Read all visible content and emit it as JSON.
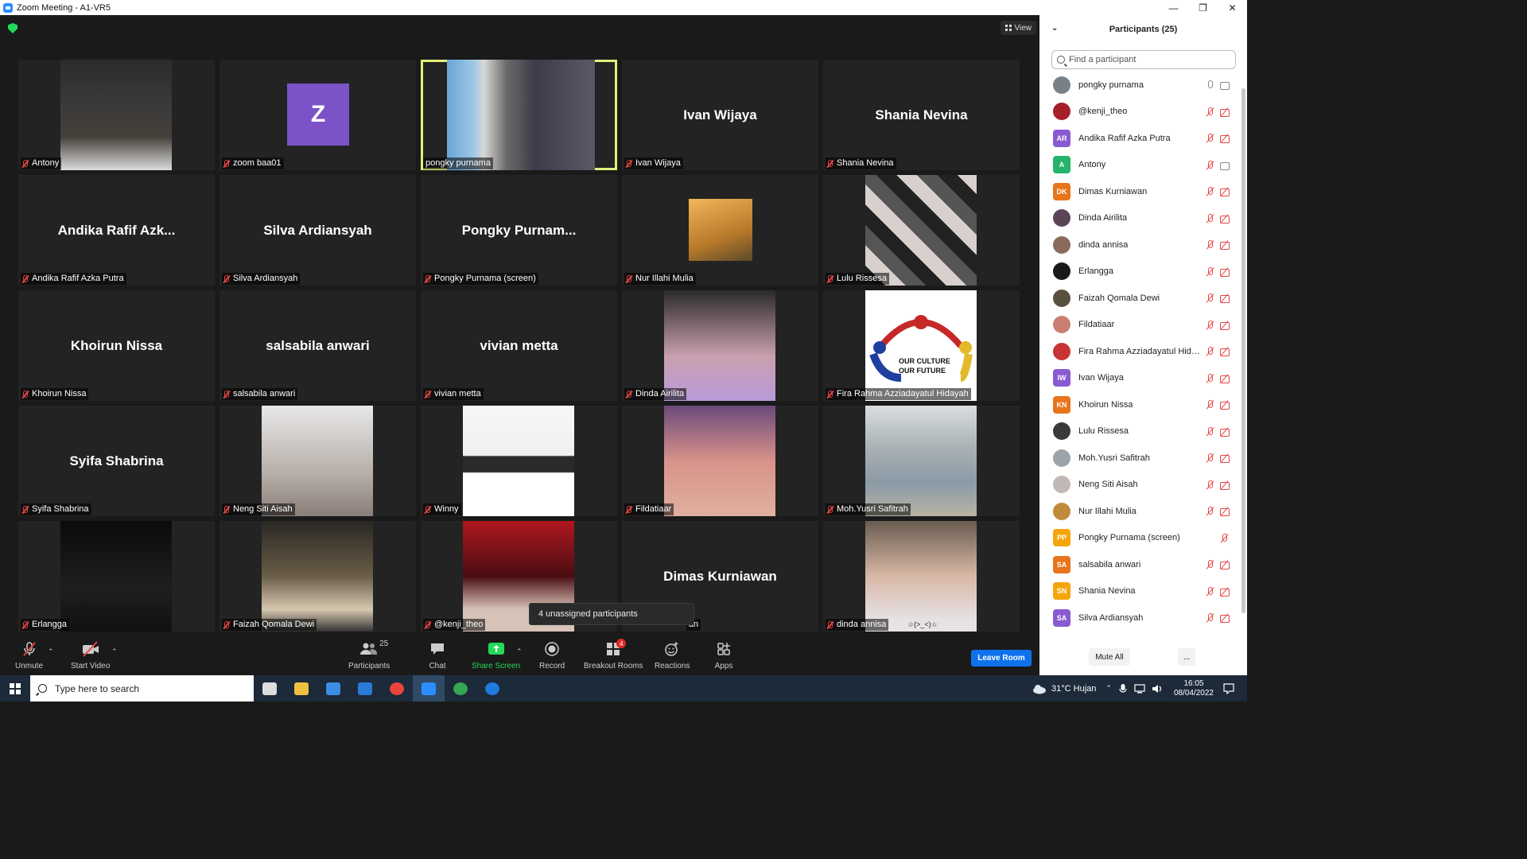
{
  "window": {
    "title": "Zoom Meeting - A1-VR5",
    "controls": [
      "—",
      "❐",
      "✕"
    ]
  },
  "meeting": {
    "view_label": "View",
    "tiles": [
      {
        "name": "Antony",
        "type": "photo",
        "photo": "ph-antony",
        "muted": true
      },
      {
        "name": "zoom baa01",
        "type": "avatar",
        "initial": "Z",
        "muted": true
      },
      {
        "name": "pongky purnama",
        "type": "photo",
        "photo": "ph-pongky",
        "muted": false,
        "active": true
      },
      {
        "name": "Ivan Wijaya",
        "type": "text",
        "display": "Ivan Wijaya",
        "muted": true
      },
      {
        "name": "Shania Nevina",
        "type": "text",
        "display": "Shania Nevina",
        "muted": true
      },
      {
        "name": "Andika Rafif Azka Putra",
        "type": "text",
        "display": "Andika  Rafif  Azk...",
        "muted": true
      },
      {
        "name": "Silva Ardiansyah",
        "type": "text",
        "display": "Silva Ardiansyah",
        "muted": true
      },
      {
        "name": "Pongky Purnama (screen)",
        "type": "text",
        "display": "Pongky  Purnam...",
        "muted": true
      },
      {
        "name": "Nur Illahi Mulia",
        "type": "photo-small",
        "photo": "ph-nur",
        "muted": true
      },
      {
        "name": "Lulu Rissesa",
        "type": "photo",
        "photo": "ph-lulu",
        "muted": true
      },
      {
        "name": "Khoirun Nissa",
        "type": "text",
        "display": "Khoirun Nissa",
        "muted": true
      },
      {
        "name": "salsabila anwari",
        "type": "text",
        "display": "salsabila anwari",
        "muted": true
      },
      {
        "name": "vivian metta",
        "type": "text",
        "display": "vivian metta",
        "muted": true
      },
      {
        "name": "Dinda Airilita",
        "type": "photo",
        "photo": "ph-dinda",
        "muted": true
      },
      {
        "name": "Fira Rahma Azziadayatul Hidayah",
        "type": "logo",
        "photo": "ph-fira",
        "logo_text": [
          "OUR CULTURE",
          "OUR FUTURE"
        ],
        "muted": true
      },
      {
        "name": "Syifa Shabrina",
        "type": "text",
        "display": "Syifa Shabrina",
        "muted": true
      },
      {
        "name": "Neng Siti Aisah",
        "type": "photo",
        "photo": "ph-neng",
        "muted": true
      },
      {
        "name": "Winny",
        "type": "photo",
        "photo": "ph-winny",
        "muted": true
      },
      {
        "name": "Fildatiaar",
        "type": "photo",
        "photo": "ph-fild",
        "muted": true
      },
      {
        "name": "Moh.Yusri Safitrah",
        "type": "photo",
        "photo": "ph-moh",
        "muted": true
      },
      {
        "name": "Erlangga",
        "type": "photo",
        "photo": "ph-erl",
        "muted": true
      },
      {
        "name": "Faizah Qomala Dewi",
        "type": "photo",
        "photo": "ph-faizah",
        "muted": true
      },
      {
        "name": "@kenji_theo",
        "type": "photo",
        "photo": "ph-kenji",
        "muted": true
      },
      {
        "name": "Dimas Kurniawan",
        "type": "text",
        "display": "Dimas Kurniawan",
        "muted": false,
        "tag_hidden": true,
        "tag_tail": "an"
      },
      {
        "name": "dinda annisa",
        "type": "photo",
        "photo": "ph-dindaa",
        "muted": true,
        "extra": "☆(>_<)☆"
      }
    ],
    "tooltip": "4 unassigned participants",
    "colors": {
      "active_border": "#e1f07a",
      "muted_red": "#e54545",
      "security_green": "#23d959"
    }
  },
  "toolbar": {
    "unmute": "Unmute",
    "start_video": "Start Video",
    "participants": "Participants",
    "participants_count": "25",
    "chat": "Chat",
    "share_screen": "Share Screen",
    "record": "Record",
    "breakout_rooms": "Breakout Rooms",
    "breakout_badge": "4",
    "reactions": "Reactions",
    "apps": "Apps",
    "leave_room": "Leave Room",
    "caret": "⌃"
  },
  "panel": {
    "title": "Participants (25)",
    "search_placeholder": "Find a participant",
    "mute_all": "Mute All",
    "more": "...",
    "participants": [
      {
        "name": "pongky purnama",
        "avatar": "photo",
        "color": "#7a8088",
        "mic": "on",
        "video": "on"
      },
      {
        "name": "@kenji_theo",
        "avatar": "photo",
        "color": "#a51e28",
        "mic": "off",
        "video": "off"
      },
      {
        "name": "Andika Rafif Azka Putra",
        "avatar": "AR",
        "color": "#8a5ad2",
        "mic": "off",
        "video": "off"
      },
      {
        "name": "Antony",
        "avatar": "A",
        "color": "#23b36b",
        "mic": "off",
        "video": "on"
      },
      {
        "name": "Dimas Kurniawan",
        "avatar": "DK",
        "color": "#e8741b",
        "mic": "off",
        "video": "off"
      },
      {
        "name": "Dinda Airilita",
        "avatar": "photo",
        "color": "#5a4458",
        "mic": "off",
        "video": "off"
      },
      {
        "name": "dinda annisa",
        "avatar": "photo",
        "color": "#8a6a5a",
        "mic": "off",
        "video": "off"
      },
      {
        "name": "Erlangga",
        "avatar": "photo",
        "color": "#1a1a1a",
        "mic": "off",
        "video": "off"
      },
      {
        "name": "Faizah Qomala Dewi",
        "avatar": "photo",
        "color": "#5a5040",
        "mic": "off",
        "video": "off"
      },
      {
        "name": "Fildatiaar",
        "avatar": "photo",
        "color": "#c98070",
        "mic": "off",
        "video": "off"
      },
      {
        "name": "Fira Rahma Azziadayatul Hiday...",
        "avatar": "photo",
        "color": "#c83434",
        "mic": "off",
        "video": "off"
      },
      {
        "name": "Ivan Wijaya",
        "avatar": "IW",
        "color": "#8a5ad2",
        "mic": "off",
        "video": "off"
      },
      {
        "name": "Khoirun Nissa",
        "avatar": "KN",
        "color": "#e8741b",
        "mic": "off",
        "video": "off"
      },
      {
        "name": "Lulu Rissesa",
        "avatar": "photo",
        "color": "#3a3a3a",
        "mic": "off",
        "video": "off"
      },
      {
        "name": "Moh.Yusri Safitrah",
        "avatar": "photo",
        "color": "#9aa4aa",
        "mic": "off",
        "video": "off"
      },
      {
        "name": "Neng Siti Aisah",
        "avatar": "photo",
        "color": "#c0b8b4",
        "mic": "off",
        "video": "off"
      },
      {
        "name": "Nur Illahi Mulia",
        "avatar": "photo",
        "color": "#c08a3a",
        "mic": "off",
        "video": "off"
      },
      {
        "name": "Pongky Purnama (screen)",
        "avatar": "PP",
        "color": "#f5a50a",
        "mic": "off",
        "video": "none"
      },
      {
        "name": "salsabila anwari",
        "avatar": "SA",
        "color": "#e8741b",
        "mic": "off",
        "video": "off"
      },
      {
        "name": "Shania Nevina",
        "avatar": "SN",
        "color": "#f5a50a",
        "mic": "off",
        "video": "off"
      },
      {
        "name": "Silva Ardiansyah",
        "avatar": "SA",
        "color": "#8a5ad2",
        "mic": "off",
        "video": "off"
      }
    ]
  },
  "taskbar": {
    "search_placeholder": "Type here to search",
    "weather": "31°C  Hujan",
    "time": "16:05",
    "date": "08/04/2022",
    "apps": [
      {
        "name": "task-view-icon",
        "color": "#dddddd"
      },
      {
        "name": "file-explorer-icon",
        "color": "#f0c040"
      },
      {
        "name": "store-icon",
        "color": "#3a8ee6"
      },
      {
        "name": "mail-icon",
        "color": "#2a7ad8"
      },
      {
        "name": "chrome-icon",
        "color": "#e8453c"
      },
      {
        "name": "zoom-icon",
        "color": "#2d8cff"
      },
      {
        "name": "chrome-profile-icon",
        "color": "#34a853"
      },
      {
        "name": "teamviewer-icon",
        "color": "#1e7be0"
      }
    ]
  }
}
